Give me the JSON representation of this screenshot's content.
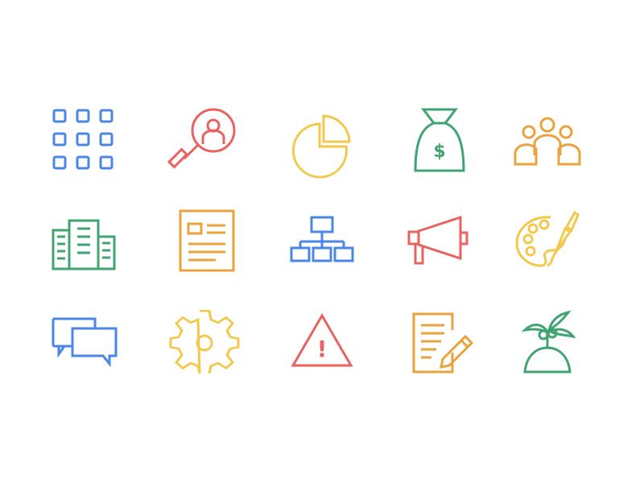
{
  "colors": {
    "blue": "#4a86e4",
    "red": "#e8635f",
    "yellow": "#f2c94c",
    "green": "#3fa472",
    "orange": "#e8a33d",
    "background": "#ffffff"
  },
  "icons": [
    {
      "name": "apps-grid-icon",
      "color": "blue"
    },
    {
      "name": "user-search-icon",
      "color": "red"
    },
    {
      "name": "pie-chart-icon",
      "color": "yellow"
    },
    {
      "name": "money-bag-icon",
      "color": "green",
      "glyph": "$"
    },
    {
      "name": "team-icon",
      "color": "orange"
    },
    {
      "name": "buildings-icon",
      "color": "green"
    },
    {
      "name": "document-icon",
      "color": "orange"
    },
    {
      "name": "org-chart-icon",
      "color": "blue"
    },
    {
      "name": "megaphone-icon",
      "color": "red"
    },
    {
      "name": "paint-palette-icon",
      "color": "yellow"
    },
    {
      "name": "chat-bubbles-icon",
      "color": "blue"
    },
    {
      "name": "gear-icon",
      "color": "yellow"
    },
    {
      "name": "warning-icon",
      "color": "red",
      "glyph": "!"
    },
    {
      "name": "edit-document-icon",
      "color": "orange"
    },
    {
      "name": "island-icon",
      "color": "green"
    }
  ]
}
